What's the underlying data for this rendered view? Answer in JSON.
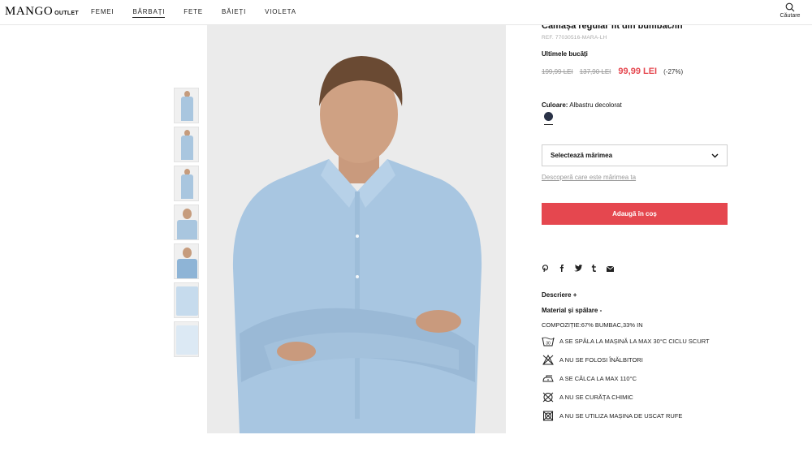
{
  "brand": {
    "name": "MANGO",
    "sub": "OUTLET"
  },
  "nav": [
    "FEMEI",
    "BĂRBAȚI",
    "FETE",
    "BĂIEȚI",
    "VIOLETA"
  ],
  "search": {
    "label": "Căutare"
  },
  "product": {
    "title": "Cămașă regular fit din bumbac/in",
    "ref": "REF. 77030516-MARA-LH",
    "stock": "Ultimele bucăți",
    "price_original": "199,99 LEI",
    "price_previous": "137,90 LEI",
    "price_sale": "99,99 LEI",
    "discount": "(-27%)",
    "color_label": "Culoare:",
    "color_name": "Albastru decolorat",
    "color_hex": "#2a3247",
    "size_select": "Selectează mărimea",
    "size_help": "Descoperă care este mărimea ta",
    "add_to_cart": "Adaugă în coș"
  },
  "social_icons": [
    "pinterest-icon",
    "facebook-icon",
    "twitter-icon",
    "tumblr-icon",
    "email-icon"
  ],
  "sections": {
    "description": "Descriere +",
    "material": "Material și spălare -",
    "composition": "COMPOZIȚIE:67% BUMBAC,33% IN"
  },
  "care": [
    {
      "icon": "wash-30-icon",
      "text": "A SE SPĂLA LA MAȘINĂ LA MAX 30°C CICLU SCURT"
    },
    {
      "icon": "no-bleach-icon",
      "text": "A NU SE FOLOSI ÎNĂLBITORI"
    },
    {
      "icon": "iron-icon",
      "text": "A SE CĂLCA LA MAX 110°C"
    },
    {
      "icon": "no-dry-clean-icon",
      "text": "A NU SE CURĂȚA CHIMIC"
    },
    {
      "icon": "no-tumble-dry-icon",
      "text": "A NU SE UTILIZA MAȘINA DE USCAT RUFE"
    }
  ],
  "colors": {
    "accent": "#e5474f",
    "text": "#111111",
    "muted": "#999999"
  }
}
